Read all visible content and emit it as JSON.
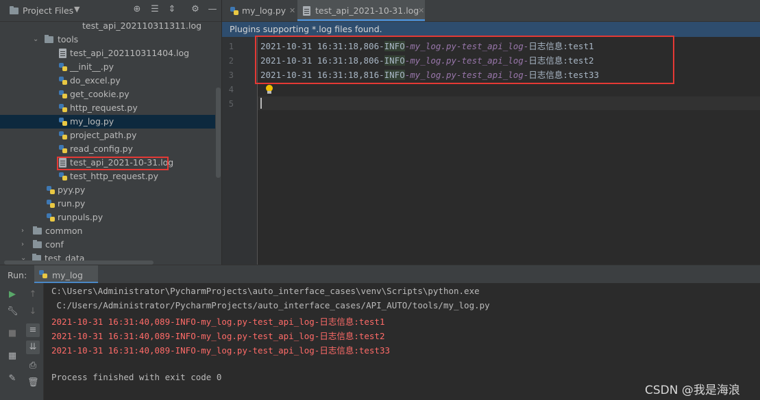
{
  "project_panel": {
    "title": "Project Files",
    "tree": [
      {
        "label": "test_api_202110311311.log",
        "kind": "log"
      },
      {
        "label": "tools",
        "kind": "folder"
      },
      {
        "label": "test_api_202110311404.log",
        "kind": "log"
      },
      {
        "label": "__init__.py",
        "kind": "py"
      },
      {
        "label": "do_excel.py",
        "kind": "py"
      },
      {
        "label": "get_cookie.py",
        "kind": "py"
      },
      {
        "label": "http_request.py",
        "kind": "py"
      },
      {
        "label": "my_log.py",
        "kind": "py",
        "selected": true
      },
      {
        "label": "project_path.py",
        "kind": "py"
      },
      {
        "label": "read_config.py",
        "kind": "py"
      },
      {
        "label": "test_api_2021-10-31.log",
        "kind": "log",
        "highlighted": true
      },
      {
        "label": "test_http_request.py",
        "kind": "py"
      },
      {
        "label": "pyy.py",
        "kind": "py"
      },
      {
        "label": "run.py",
        "kind": "py"
      },
      {
        "label": "runpuls.py",
        "kind": "py"
      },
      {
        "label": "common",
        "kind": "folder"
      },
      {
        "label": "conf",
        "kind": "folder"
      },
      {
        "label": "test_data",
        "kind": "folder"
      }
    ]
  },
  "editor": {
    "tabs": [
      {
        "label": "my_log.py",
        "active": false
      },
      {
        "label": "test_api_2021-10-31.log",
        "active": true
      }
    ],
    "notice": "Plugins supporting *.log files found.",
    "line_numbers": [
      "1",
      "2",
      "3",
      "4",
      "5"
    ],
    "lines": [
      {
        "time": "2021-10-31 16:31:18,806-",
        "level": "INFO",
        "name": "-my_log.py-test_api_log-",
        "msg": "日志信息:test1"
      },
      {
        "time": "2021-10-31 16:31:18,806-",
        "level": "INFO",
        "name": "-my_log.py-test_api_log-",
        "msg": "日志信息:test2"
      },
      {
        "time": "2021-10-31 16:31:18,816-",
        "level": "INFO",
        "name": "-my_log.py-test_api_log-",
        "msg": "日志信息:test33"
      }
    ]
  },
  "run_panel": {
    "label": "Run:",
    "tab": "my_log",
    "console": [
      {
        "text": "C:\\Users\\Administrator\\PycharmProjects\\auto_interface_cases\\venv\\Scripts\\python.exe",
        "kind": "path"
      },
      {
        "text": " C:/Users/Administrator/PycharmProjects/auto_interface_cases/API_AUTO/tools/my_log.py",
        "kind": "path"
      },
      {
        "text": "2021-10-31 16:31:40,089-INFO-my_log.py-test_api_log-日志信息:test1",
        "kind": "err"
      },
      {
        "text": "2021-10-31 16:31:40,089-INFO-my_log.py-test_api_log-日志信息:test2",
        "kind": "err"
      },
      {
        "text": "2021-10-31 16:31:40,089-INFO-my_log.py-test_api_log-日志信息:test33",
        "kind": "err"
      },
      {
        "text": "Process finished with exit code 0",
        "kind": "done"
      }
    ]
  },
  "watermark": "CSDN @我是海浪",
  "colors": {
    "panel_bg": "#3c3f41",
    "editor_bg": "#2b2b2b",
    "selection": "#0d293e",
    "accent": "#4a88c7",
    "highlight_box": "#e53935",
    "console_error": "#ff6b68",
    "log_name": "#9876aa"
  },
  "icons": [
    "folder-icon",
    "locate-icon",
    "collapse-all-icon",
    "expand-all-icon",
    "gear-icon",
    "minimize-icon",
    "python-file-icon",
    "log-file-icon",
    "run-icon",
    "wrench-icon",
    "stop-icon",
    "layout-icon",
    "pin-icon",
    "arrow-up-icon",
    "arrow-down-icon",
    "soft-wrap-icon",
    "scroll-to-end-icon",
    "print-icon",
    "trash-icon",
    "bulb-icon"
  ]
}
